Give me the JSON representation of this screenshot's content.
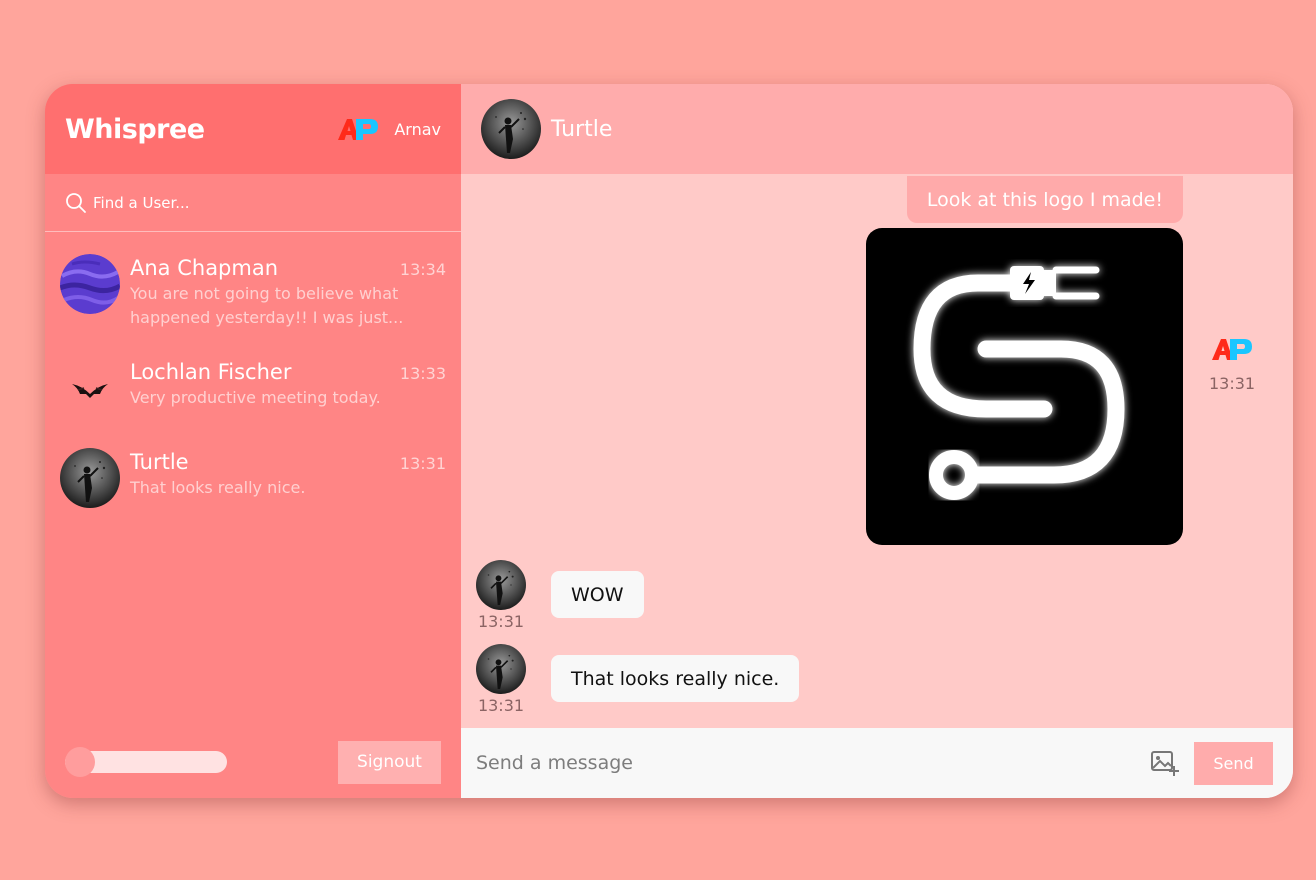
{
  "sidebar": {
    "brand": "Whispree",
    "user": {
      "name": "Arnav",
      "logo_icon": "ap-logo-icon"
    },
    "search": {
      "placeholder": "Find a User...",
      "value": ""
    },
    "chats": [
      {
        "name": "Ana Chapman",
        "time": "13:34",
        "preview": "You are not going to believe what happened yesterday!! I was just...",
        "avatar_icon": "purple-planet-avatar"
      },
      {
        "name": "Lochlan Fischer",
        "time": "13:33",
        "preview": "Very productive meeting today.",
        "avatar_icon": "dark-bird-avatar"
      },
      {
        "name": "Turtle",
        "time": "13:31",
        "preview": "That looks really nice.",
        "avatar_icon": "grey-figure-avatar"
      }
    ],
    "toggle_on": false,
    "signout_label": "Signout"
  },
  "conversation": {
    "title": "Turtle",
    "messages": [
      {
        "direction": "out",
        "text": "Look at this logo I made!",
        "image": "plug-s-logo-icon",
        "time": "13:31"
      },
      {
        "direction": "in",
        "text": "WOW",
        "time": "13:31"
      },
      {
        "direction": "in",
        "text": "That looks really nice.",
        "time": "13:31"
      }
    ],
    "composer": {
      "placeholder": "Send a message",
      "value": "",
      "send_label": "Send",
      "attach_icon": "add-image-icon"
    }
  },
  "colors": {
    "page_background": "#ffa59c",
    "sidebar": "#ff8585",
    "sidebar_header": "#ff6f6f",
    "chat_background": "#ffcac8",
    "chat_header": "#ffacac",
    "outgoing_bubble": "#ffaaaa",
    "incoming_bubble": "#f8f8f8"
  }
}
